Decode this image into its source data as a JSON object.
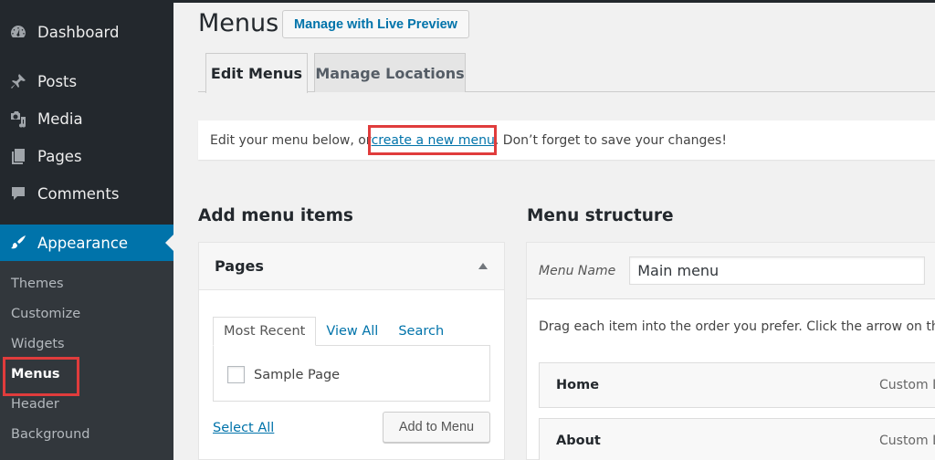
{
  "sidebar": {
    "items": [
      {
        "label": "Dashboard",
        "icon": "dashboard-icon"
      },
      {
        "label": "Posts",
        "icon": "pushpin-icon"
      },
      {
        "label": "Media",
        "icon": "media-icon"
      },
      {
        "label": "Pages",
        "icon": "pages-icon"
      },
      {
        "label": "Comments",
        "icon": "comment-icon"
      },
      {
        "label": "Appearance",
        "icon": "paintbrush-icon",
        "active": true
      }
    ],
    "submenu": [
      {
        "label": "Themes"
      },
      {
        "label": "Customize"
      },
      {
        "label": "Widgets"
      },
      {
        "label": "Menus",
        "current": true
      },
      {
        "label": "Header"
      },
      {
        "label": "Background"
      }
    ],
    "accent_color": "#0073aa"
  },
  "header": {
    "title": "Menus",
    "live_preview_label": "Manage with Live Preview"
  },
  "tabs": [
    {
      "label": "Edit Menus",
      "active": true
    },
    {
      "label": "Manage Locations",
      "active": false
    }
  ],
  "notice": {
    "before": "Edit your menu below, or ",
    "link": "create a new menu",
    "after": ". Don’t forget to save your changes!"
  },
  "add_items": {
    "title": "Add menu items",
    "panel_title": "Pages",
    "tabs": [
      "Most Recent",
      "View All",
      "Search"
    ],
    "items": [
      {
        "label": "Sample Page",
        "checked": false
      }
    ],
    "select_all": "Select All",
    "add_button": "Add to Menu"
  },
  "structure": {
    "title": "Menu structure",
    "menu_name_label": "Menu Name",
    "menu_name_value": "Main menu",
    "hint": "Drag each item into the order you prefer. Click the arrow on the",
    "items": [
      {
        "title": "Home",
        "type": "Custom Li"
      },
      {
        "title": "About",
        "type": "Custom Li"
      }
    ]
  },
  "annotation_color": "#e03c3c"
}
